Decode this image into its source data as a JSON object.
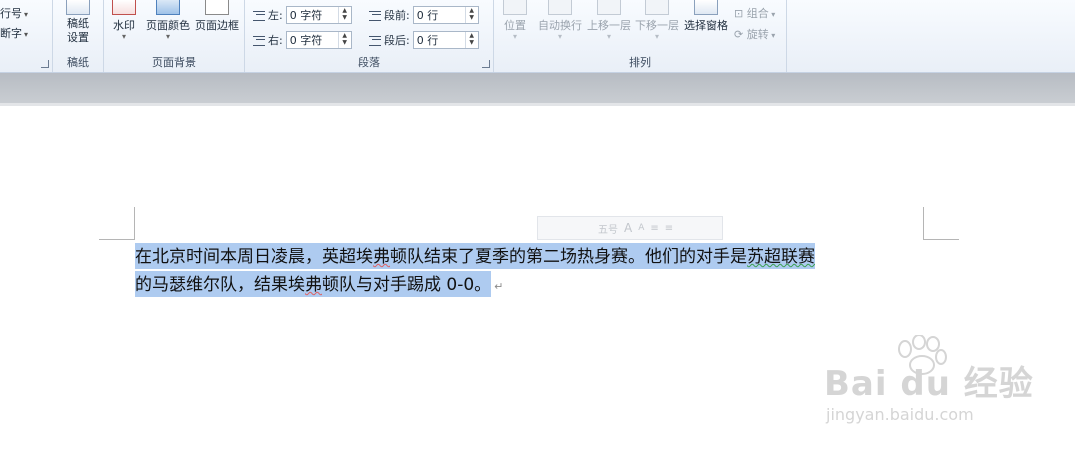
{
  "ribbon": {
    "partial_group": {
      "line_numbers": "行号",
      "hyphenation": "断字"
    },
    "manuscript_group": {
      "button": "稿纸设置",
      "label": "稿纸"
    },
    "page_background": {
      "label": "页面背景",
      "watermark": "水印",
      "page_color": "页面颜色",
      "page_border": "页面边框"
    },
    "paragraph": {
      "label": "段落",
      "indent_left_label": "左:",
      "indent_left_value": "0 字符",
      "indent_right_label": "右:",
      "indent_right_value": "0 字符",
      "spacing_before_label": "段前:",
      "spacing_before_value": "0 行",
      "spacing_after_label": "段后:",
      "spacing_after_value": "0 行"
    },
    "arrange": {
      "label": "排列",
      "position": "位置",
      "wrap_text": "自动换行",
      "bring_forward": "上移一层",
      "send_backward": "下移一层",
      "selection_pane": "选择窗格",
      "group": "组合",
      "rotate": "旋转"
    }
  },
  "mini_toolbar": {
    "font_size": "五号",
    "grow": "A",
    "shrink": "A"
  },
  "document": {
    "line1_a": "在北京时间本周日凌晨，英超埃",
    "line1_b": "弗",
    "line1_c": "顿队结束了夏季的第二场热身赛。他们的对手是",
    "line1_d": "苏超联赛",
    "line2_a": "的马瑟维尔队，结果埃",
    "line2_b": "弗",
    "line2_c": "顿队与对手踢成 0-0。",
    "para_mark": "↵"
  },
  "watermark": {
    "logo": "Bai du 经验",
    "url": "jingyan.baidu.com"
  }
}
